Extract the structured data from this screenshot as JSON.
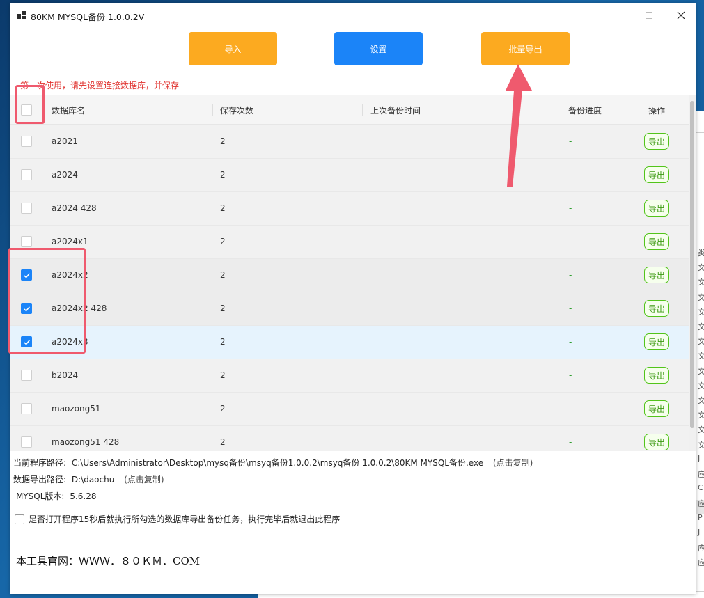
{
  "window": {
    "title": "80KM MYSQL备份 1.0.0.2V"
  },
  "toolbar": {
    "import_label": "导入",
    "settings_label": "设置",
    "batch_export_label": "批量导出"
  },
  "hint": "第一次使用，请先设置连接数据库，并保存",
  "table": {
    "columns": [
      "数据库名",
      "保存次数",
      "上次备份时间",
      "备份进度",
      "操作"
    ],
    "rows": [
      {
        "name": "a2021",
        "count": "2",
        "last_backup": "",
        "progress": "-",
        "action": "导出",
        "checked": false
      },
      {
        "name": "a2024",
        "count": "2",
        "last_backup": "",
        "progress": "-",
        "action": "导出",
        "checked": false
      },
      {
        "name": "a2024 428",
        "count": "2",
        "last_backup": "",
        "progress": "-",
        "action": "导出",
        "checked": false
      },
      {
        "name": "a2024x1",
        "count": "2",
        "last_backup": "",
        "progress": "-",
        "action": "导出",
        "checked": false
      },
      {
        "name": "a2024x2",
        "count": "2",
        "last_backup": "",
        "progress": "-",
        "action": "导出",
        "checked": true
      },
      {
        "name": "a2024x2 428",
        "count": "2",
        "last_backup": "",
        "progress": "-",
        "action": "导出",
        "checked": true
      },
      {
        "name": "a2024x3",
        "count": "2",
        "last_backup": "",
        "progress": "-",
        "action": "导出",
        "checked": true
      },
      {
        "name": "b2024",
        "count": "2",
        "last_backup": "",
        "progress": "-",
        "action": "导出",
        "checked": false
      },
      {
        "name": "maozong51",
        "count": "2",
        "last_backup": "",
        "progress": "-",
        "action": "导出",
        "checked": false
      },
      {
        "name": "maozong51 428",
        "count": "2",
        "last_backup": "",
        "progress": "-",
        "action": "导出",
        "checked": false
      }
    ]
  },
  "info": {
    "program_path_label": "当前程序路径:",
    "program_path": "C:\\Users\\Administrator\\Desktop\\mysq备份\\msyq备份1.0.0.2\\msyq备份 1.0.0.2\\80KM MYSQL备份.exe",
    "program_path_hint": "(点击复制)",
    "export_path_label": "数据导出路径:",
    "export_path": "D:\\daochu",
    "export_path_hint": "(点击复制)",
    "mysql_version_label": "MYSQL版本:",
    "mysql_version": "5.6.28"
  },
  "auto_run_label": "是否打开程序15秒后就执行所勾选的数据库导出备份任务，执行完毕后就退出此程序",
  "website": "本工具官网：ＷＷＷ．８０ＫＭ．COM",
  "background_window": {
    "lines": [
      "类",
      "文",
      "文",
      "文",
      "文",
      "文",
      "文",
      "文",
      "文",
      "文",
      "文",
      "文",
      "文",
      "文",
      "J",
      "应",
      "C",
      "应",
      "P",
      "J",
      "应",
      "应"
    ]
  },
  "colors": {
    "orange_button": "#fcaa20",
    "blue_button": "#1b84f8",
    "hint_red": "#e0302c",
    "annotation_red": "#ef5a6e",
    "export_green": "#52c41a"
  }
}
